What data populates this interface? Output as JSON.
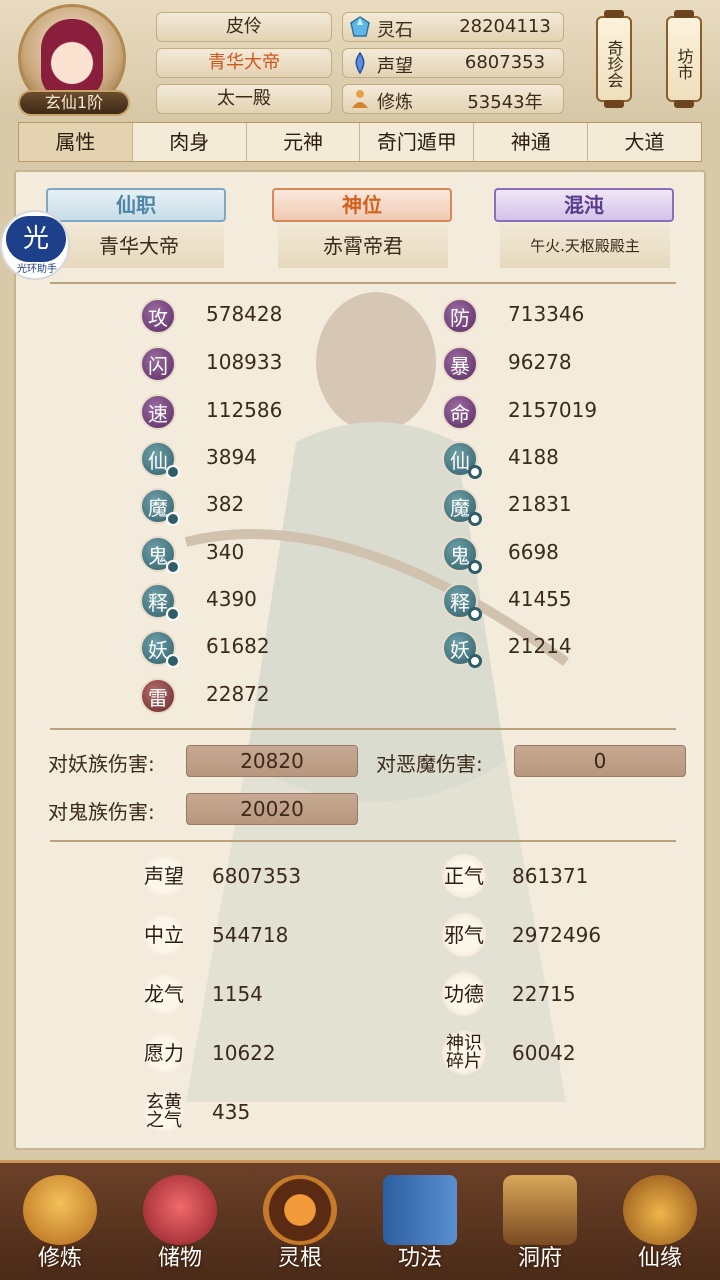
{
  "header": {
    "rank": "玄仙1阶",
    "titles": [
      "皮伶",
      "青华大帝",
      "太一殿"
    ],
    "resources": [
      {
        "icon": "spirit-stone-icon",
        "label": "灵石",
        "value": "28204113"
      },
      {
        "icon": "prestige-icon",
        "label": "声望",
        "value": "6807353"
      },
      {
        "icon": "cultivation-icon",
        "label": "修炼",
        "value": "53543年"
      }
    ],
    "side_tabs": [
      "奇珍会",
      "坊市"
    ]
  },
  "tabs": [
    "属性",
    "肉身",
    "元神",
    "奇门遁甲",
    "神通",
    "大道"
  ],
  "active_tab": 0,
  "ranks": [
    {
      "header": "仙职",
      "value": "青华大帝",
      "color": "#4e86a6"
    },
    {
      "header": "神位",
      "value": "赤霄帝君",
      "color": "#d2621f"
    },
    {
      "header": "混沌",
      "value": "午火.天枢殿殿主",
      "color": "#5a3d8a"
    }
  ],
  "stats_left": [
    {
      "glyph": "攻",
      "value": "578428",
      "style": "purple",
      "sub": ""
    },
    {
      "glyph": "闪",
      "value": "108933",
      "style": "purple",
      "sub": ""
    },
    {
      "glyph": "速",
      "value": "112586",
      "style": "purple",
      "sub": ""
    },
    {
      "glyph": "仙",
      "value": "3894",
      "style": "teal",
      "sub": "dot"
    },
    {
      "glyph": "魔",
      "value": "382",
      "style": "teal",
      "sub": "dot"
    },
    {
      "glyph": "鬼",
      "value": "340",
      "style": "teal",
      "sub": "dot"
    },
    {
      "glyph": "释",
      "value": "4390",
      "style": "teal",
      "sub": "dot"
    },
    {
      "glyph": "妖",
      "value": "61682",
      "style": "teal",
      "sub": "dot"
    },
    {
      "glyph": "雷",
      "value": "22872",
      "style": "red",
      "sub": ""
    }
  ],
  "stats_right": [
    {
      "glyph": "防",
      "value": "713346",
      "style": "purple",
      "sub": ""
    },
    {
      "glyph": "暴",
      "value": "96278",
      "style": "purple",
      "sub": ""
    },
    {
      "glyph": "命",
      "value": "2157019",
      "style": "purple",
      "sub": ""
    },
    {
      "glyph": "仙",
      "value": "4188",
      "style": "teal",
      "sub": "ring"
    },
    {
      "glyph": "魔",
      "value": "21831",
      "style": "teal",
      "sub": "ring"
    },
    {
      "glyph": "鬼",
      "value": "6698",
      "style": "teal",
      "sub": "ring"
    },
    {
      "glyph": "释",
      "value": "41455",
      "style": "teal",
      "sub": "ring"
    },
    {
      "glyph": "妖",
      "value": "21214",
      "style": "teal",
      "sub": "ring"
    }
  ],
  "damage": [
    {
      "label": "对妖族伤害:",
      "value": "20820"
    },
    {
      "label": "对恶魔伤害:",
      "value": "0"
    },
    {
      "label": "对鬼族伤害:",
      "value": "20020"
    }
  ],
  "misc_left": [
    {
      "label": "声望",
      "value": "6807353"
    },
    {
      "label": "中立",
      "value": "544718"
    },
    {
      "label": "龙气",
      "value": "1154"
    },
    {
      "label": "愿力",
      "value": "10622"
    },
    {
      "label": "玄黄之气",
      "value": "435"
    }
  ],
  "misc_right": [
    {
      "label": "正气",
      "value": "861371"
    },
    {
      "label": "邪气",
      "value": "2972496"
    },
    {
      "label": "功德",
      "value": "22715"
    },
    {
      "label": "神识碎片",
      "value": "60042"
    }
  ],
  "helper": {
    "icon_text": "光",
    "label": "光环助手"
  },
  "bottom_nav": [
    {
      "label": "修炼",
      "icon": "meditation-icon"
    },
    {
      "label": "储物",
      "icon": "storage-bag-icon"
    },
    {
      "label": "灵根",
      "icon": "spirit-root-icon"
    },
    {
      "label": "功法",
      "icon": "scripture-book-icon"
    },
    {
      "label": "洞府",
      "icon": "cave-dwelling-icon"
    },
    {
      "label": "仙缘",
      "icon": "gourd-icon"
    }
  ]
}
